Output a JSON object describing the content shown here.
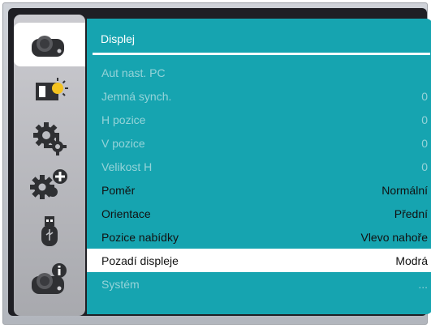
{
  "panel": {
    "title": "Displej"
  },
  "menu": [
    {
      "label": "Aut nast. PC",
      "value": "",
      "state": "dim"
    },
    {
      "label": "Jemná synch.",
      "value": "0",
      "state": "dim"
    },
    {
      "label": "H pozice",
      "value": "0",
      "state": "dim"
    },
    {
      "label": "V pozice",
      "value": "0",
      "state": "dim"
    },
    {
      "label": "Velikost H",
      "value": "0",
      "state": "dim"
    },
    {
      "label": "Poměr",
      "value": "Normální",
      "state": "on"
    },
    {
      "label": "Orientace",
      "value": "Přední",
      "state": "on"
    },
    {
      "label": "Pozice nabídky",
      "value": "Vlevo nahoře",
      "state": "on"
    },
    {
      "label": "Pozadí displeje",
      "value": "Modrá",
      "state": "sel"
    },
    {
      "label": "Systém",
      "value": "...",
      "state": "dim"
    }
  ],
  "sidebar": {
    "items": [
      {
        "icon": "projector-icon",
        "active": true
      },
      {
        "icon": "image-brightness-icon",
        "active": false
      },
      {
        "icon": "gear-icon",
        "active": false
      },
      {
        "icon": "gear-plus-icon",
        "active": false
      },
      {
        "icon": "usb-icon",
        "active": false
      },
      {
        "icon": "projector-info-icon",
        "active": false
      }
    ]
  },
  "colors": {
    "accent": "#16a4b0",
    "selected": "#ffffff",
    "sidebar": "#b9babf"
  }
}
